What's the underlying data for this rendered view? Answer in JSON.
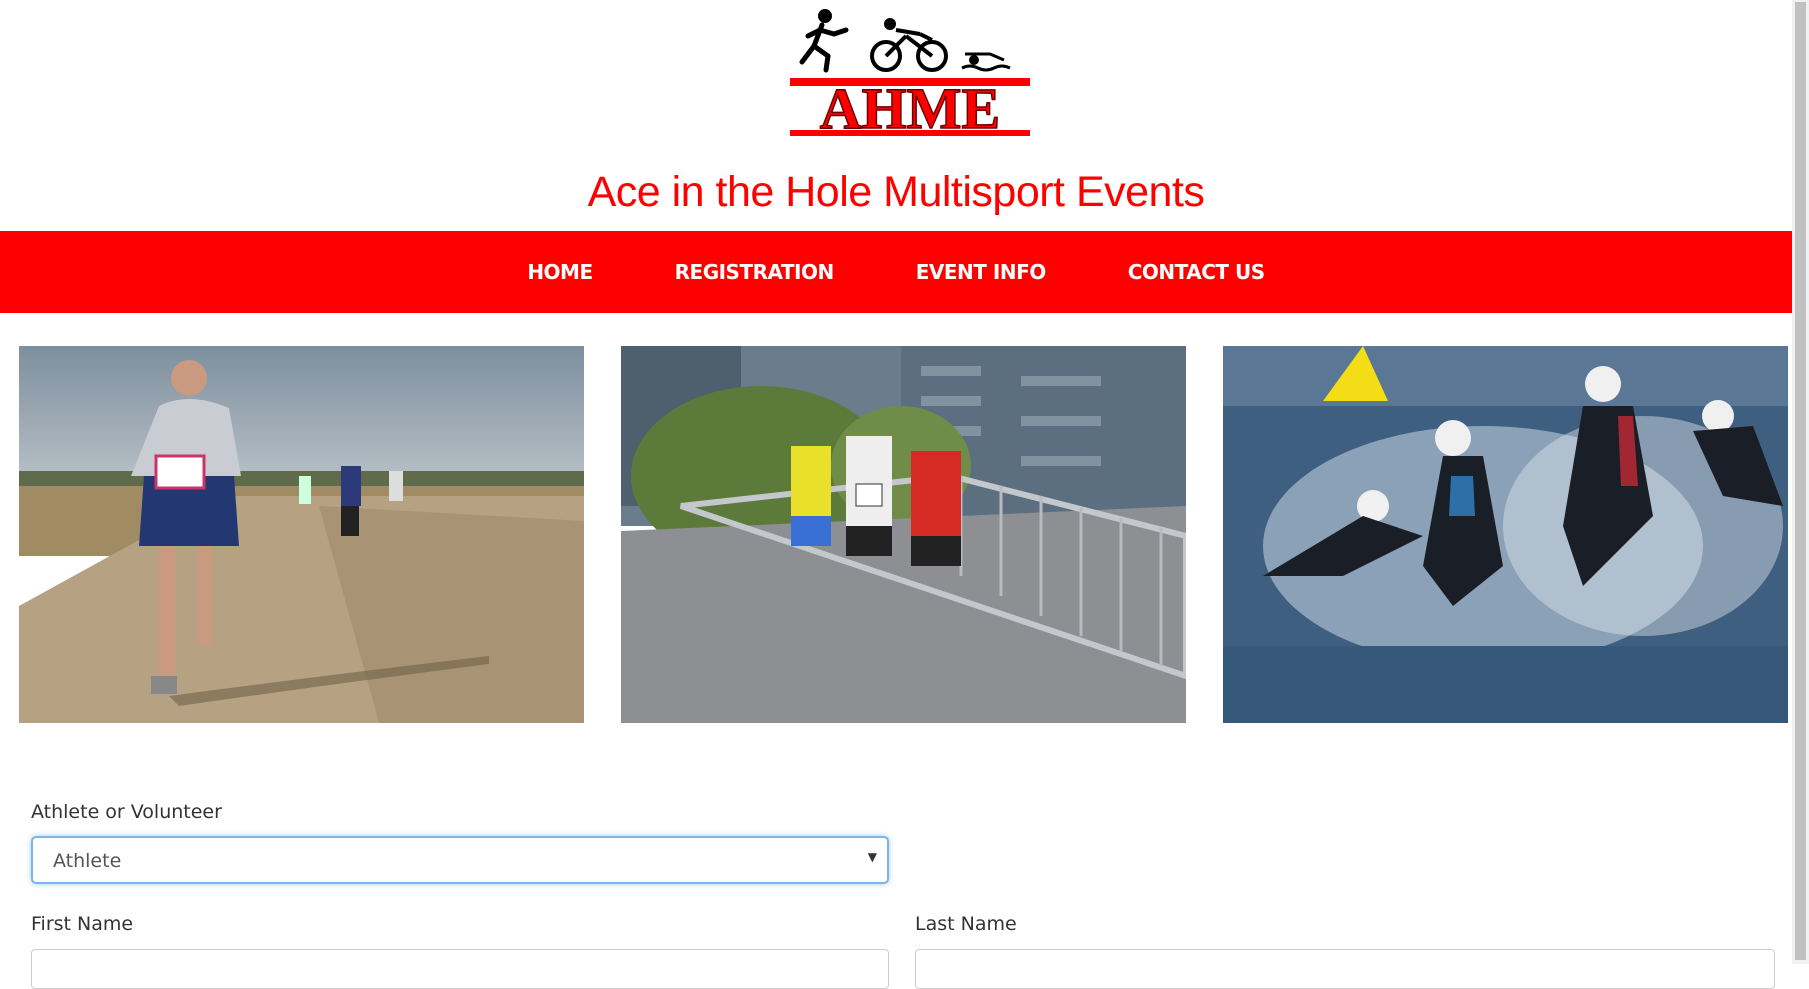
{
  "header": {
    "logo_text": "AHME",
    "site_title": "Ace in the Hole Multisport Events"
  },
  "nav": {
    "items": [
      "HOME",
      "REGISTRATION",
      "EVENT INFO",
      "CONTACT US"
    ]
  },
  "photos": [
    {
      "icon": "running-woman-photo"
    },
    {
      "icon": "runners-on-bridge-photo"
    },
    {
      "icon": "triathlon-swim-start-photo"
    }
  ],
  "form": {
    "athlete_or_volunteer_label": "Athlete or Volunteer",
    "athlete_or_volunteer_value": "Athlete",
    "first_name_label": "First Name",
    "last_name_label": "Last Name"
  },
  "colors": {
    "brand_red": "#ff0000",
    "focus_blue": "#66afe9"
  }
}
